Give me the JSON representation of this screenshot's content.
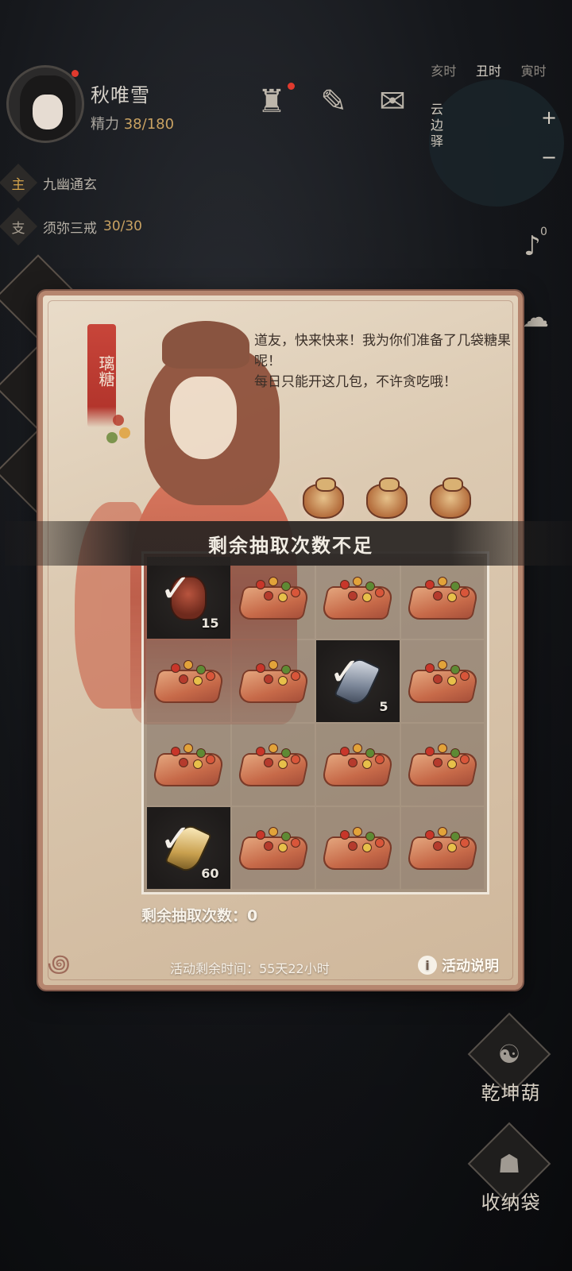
{
  "player": {
    "name": "秋唯雪",
    "stamina_label": "精力",
    "stamina_value": "38/180"
  },
  "buffs": [
    {
      "tag": "主",
      "name": "九幽通玄",
      "count": ""
    },
    {
      "tag": "支",
      "name": "须弥三戒",
      "count": "30/30"
    }
  ],
  "clock": {
    "hours": [
      "亥时",
      "丑时",
      "寅时"
    ]
  },
  "map": {
    "name": "云边驿",
    "zoom_in": "+",
    "zoom_out": "−"
  },
  "side": {
    "notify_count": "0"
  },
  "right_menu": [
    {
      "label": "乾坤葫"
    },
    {
      "label": "收纳袋"
    }
  ],
  "event": {
    "ribbon": "璃糖",
    "speech_1": "道友，快来快来！我为你们准备了几袋糖果呢！",
    "speech_2": "每日只能开这几包，不许贪吃哦！",
    "banner": "剩余抽取次数不足",
    "remaining_label": "剩余抽取次数：0",
    "time_left": "活动剩余时间：55天22小时",
    "info_label": "活动说明",
    "grid": [
      {
        "type": "redbag",
        "opened": true,
        "qty": "15"
      },
      {
        "type": "candy"
      },
      {
        "type": "candy"
      },
      {
        "type": "candy"
      },
      {
        "type": "candy"
      },
      {
        "type": "candy"
      },
      {
        "type": "crystal",
        "opened": true,
        "qty": "5"
      },
      {
        "type": "candy"
      },
      {
        "type": "candy"
      },
      {
        "type": "candy"
      },
      {
        "type": "candy"
      },
      {
        "type": "candy"
      },
      {
        "type": "gold",
        "opened": true,
        "qty": "60"
      },
      {
        "type": "candy"
      },
      {
        "type": "candy"
      },
      {
        "type": "candy"
      }
    ]
  },
  "colors": {
    "accent": "#c9a262",
    "panel_border": "#b6866f",
    "ribbon": "#c8453a"
  }
}
